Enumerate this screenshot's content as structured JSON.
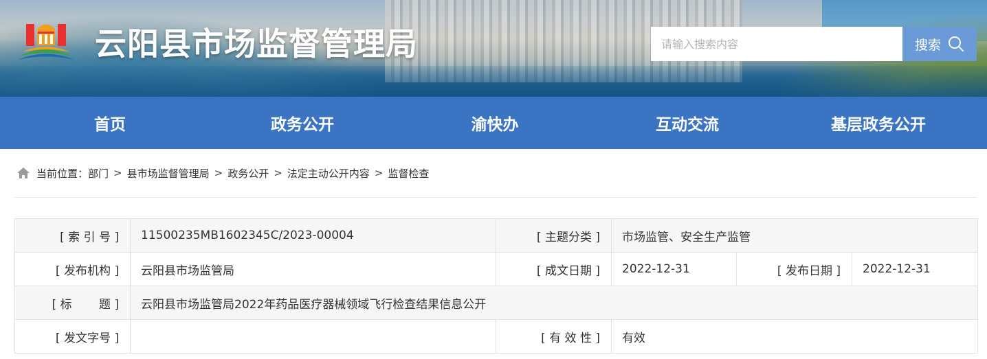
{
  "header": {
    "site_title": "云阳县市场监督管理局",
    "search_placeholder": "请输入搜索内容",
    "search_button": "搜索"
  },
  "nav": [
    {
      "label": "首页"
    },
    {
      "label": "政务公开"
    },
    {
      "label": "渝快办"
    },
    {
      "label": "互动交流"
    },
    {
      "label": "基层政务公开"
    }
  ],
  "breadcrumb": {
    "prefix": "当前位置：",
    "items": [
      "部门",
      "县市场监督管理局",
      "政务公开",
      "法定主动公开内容",
      "监督检查"
    ],
    "separator": ">"
  },
  "info": {
    "index_label": "[ 索 引 号 ]",
    "index_value": "11500235MB1602345C/2023-00004",
    "topic_label": "[ 主题分类 ]",
    "topic_value": "市场监管、安全生产监管",
    "org_label": "[ 发布机构 ]",
    "org_value": "云阳县市场监管局",
    "created_label": "[ 成文日期 ]",
    "created_value": "2022-12-31",
    "published_label": "[ 发布日期 ]",
    "published_value": "2022-12-31",
    "title_label": "[ 标 　　题 ]",
    "title_value": "云阳县市场监管局2022年药品医疗器械领域飞行检查结果信息公开",
    "docno_label": "[ 发文字号 ]",
    "docno_value": "",
    "validity_label": "[ 有 效 性 ]",
    "validity_value": "有效"
  },
  "colors": {
    "nav_bg": "#3a74c2",
    "search_button_bg": "#6b9ad8",
    "row_alt_bg": "#f6f6f6",
    "border": "#e2e2e2"
  },
  "icons": [
    "emblem-logo",
    "search-icon",
    "home-icon"
  ]
}
